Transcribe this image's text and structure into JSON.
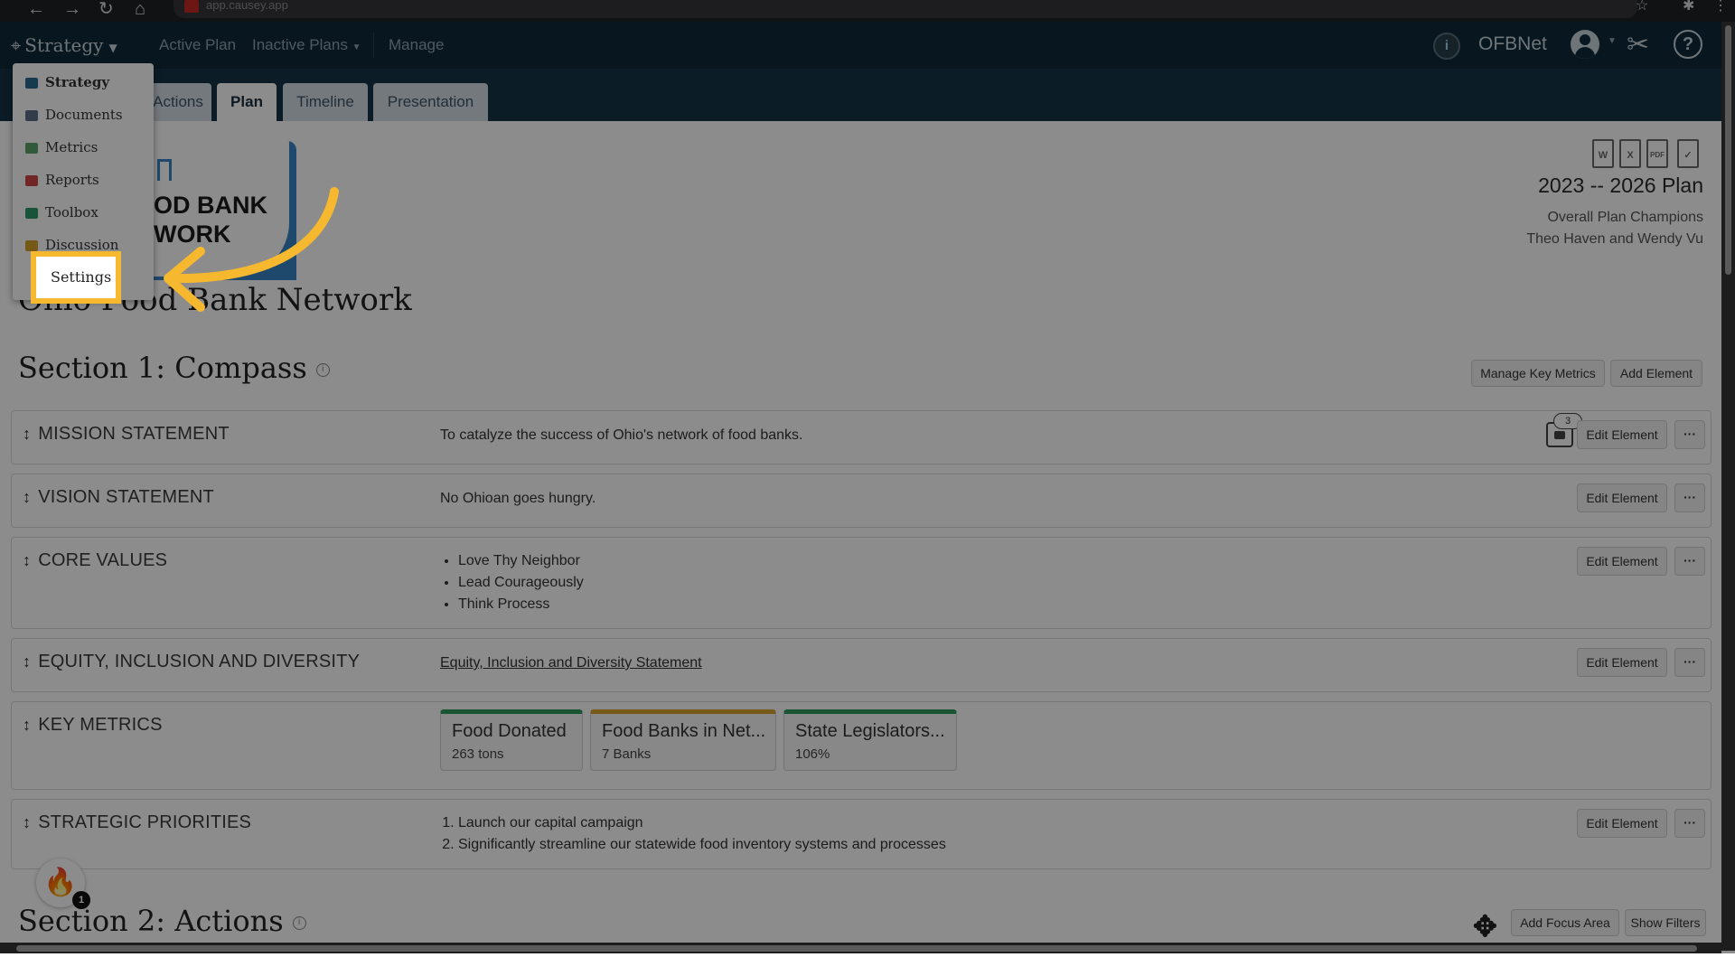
{
  "browser": {
    "url": "app.causey.app",
    "back_glyph": "←",
    "forward_glyph": "→",
    "reload_glyph": "↻",
    "home_glyph": "⌂",
    "star_glyph": "☆",
    "extensions_glyph": "✱",
    "menu_glyph": "⋮"
  },
  "header": {
    "brand": "Strategy",
    "nav": {
      "active_plan": "Active Plan",
      "inactive_plans": "Inactive Plans",
      "manage": "Manage"
    },
    "org_badge": "i",
    "org_name": "OFBNet",
    "help_glyph": "?"
  },
  "tabs": [
    {
      "label": "Actions"
    },
    {
      "label": "Plan",
      "active": true
    },
    {
      "label": "Timeline"
    },
    {
      "label": "Presentation"
    }
  ],
  "dropdown": {
    "items": [
      {
        "label": "Strategy",
        "icon": "target-icon",
        "color": "#2c6b8f"
      },
      {
        "label": "Documents",
        "icon": "folder-icon",
        "color": "#5b6f8a"
      },
      {
        "label": "Metrics",
        "icon": "chart-icon",
        "color": "#5aa36a"
      },
      {
        "label": "Reports",
        "icon": "clipboard-icon",
        "color": "#d04545"
      },
      {
        "label": "Toolbox",
        "icon": "toolbox-icon",
        "color": "#2e9a6a"
      },
      {
        "label": "Discussion",
        "icon": "chat-icon",
        "color": "#d8a12e"
      },
      {
        "label": "Settings",
        "icon": "gear-icon",
        "color": "#888888"
      }
    ]
  },
  "annotation": {
    "highlight_color": "#f5b82e"
  },
  "logo": {
    "line1": "OD BANK",
    "line2": "WORK"
  },
  "org_title": "Ohio Food Bank Network",
  "plan": {
    "file_icons": [
      "W",
      "X",
      "PDF",
      "✓"
    ],
    "title": "2023 -- 2026 Plan",
    "champions_label": "Overall Plan Champions",
    "champions_names": "Theo Haven and Wendy Vu"
  },
  "section1": {
    "title": "Section 1: Compass",
    "info": "i",
    "manage_key_metrics": "Manage Key Metrics",
    "add_element": "Add Element"
  },
  "elements": {
    "edit_label": "Edit Element",
    "more_label": "···",
    "drag_glyph": "↕",
    "mission": {
      "label": "MISSION STATEMENT",
      "value": "To catalyze the success of Ohio's network of food banks.",
      "comments": "3"
    },
    "vision": {
      "label": "VISION STATEMENT",
      "value": "No Ohioan goes hungry."
    },
    "core_values": {
      "label": "CORE VALUES",
      "items": [
        "Love Thy Neighbor",
        "Lead Courageously",
        "Think Process"
      ]
    },
    "equity": {
      "label": "EQUITY, INCLUSION AND DIVERSITY",
      "link": "Equity, Inclusion and Diversity Statement"
    },
    "key_metrics": {
      "label": "KEY METRICS",
      "cards": [
        {
          "name": "Food Donated",
          "value": "263 tons",
          "color": "#2e9a5e"
        },
        {
          "name": "Food Banks in Net...",
          "value": "7 Banks",
          "color": "#d8a12e"
        },
        {
          "name": "State Legislators...",
          "value": "106%",
          "color": "#2e9a5e"
        }
      ]
    },
    "priorities": {
      "label": "STRATEGIC PRIORITIES",
      "items": [
        "Launch our capital campaign",
        "Significantly streamline our statewide food inventory systems and processes"
      ]
    }
  },
  "section2": {
    "title": "Section 2: Actions",
    "info": "i",
    "add_focus_area": "Add Focus Area",
    "show_filters": "Show Filters"
  },
  "fire_badge": {
    "glyph": "🔥",
    "count": "1"
  }
}
